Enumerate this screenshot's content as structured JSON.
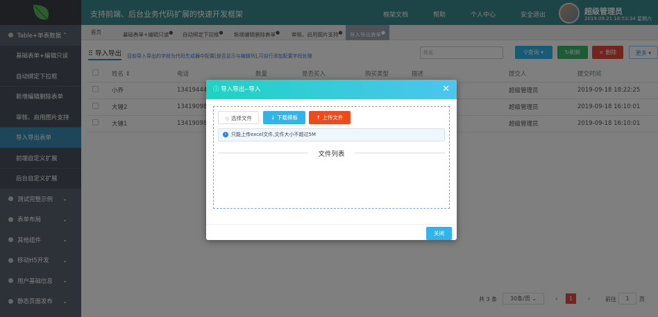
{
  "header": {
    "slogan": "支持前端、后台业务代码扩展的快速开发框架",
    "nav": [
      "框架文档",
      "帮助",
      "个人中心",
      "安全退出"
    ],
    "user_name": "超级管理员",
    "datetime": "2019.09.21 18:53:34 星期六"
  },
  "sidebar": {
    "items": [
      {
        "label": "Table+单表数据",
        "type": "top",
        "expanded": true
      },
      {
        "label": "基础表单+编辑只读",
        "type": "sub"
      },
      {
        "label": "自动绑定下拉框",
        "type": "sub"
      },
      {
        "label": "新增编辑删除表单",
        "type": "sub"
      },
      {
        "label": "审核、启用图片支持",
        "type": "sub"
      },
      {
        "label": "导入导出表单",
        "type": "sub",
        "active": true
      },
      {
        "label": "前端自定义扩展",
        "type": "sub"
      },
      {
        "label": "后台自定义扩展",
        "type": "sub"
      },
      {
        "label": "测试完整示例",
        "type": "top"
      },
      {
        "label": "表单布局",
        "type": "top"
      },
      {
        "label": "其他组件",
        "type": "top"
      },
      {
        "label": "移动H5开发",
        "type": "top"
      },
      {
        "label": "用户基础信息",
        "type": "top"
      },
      {
        "label": "静态页面发布",
        "type": "top"
      }
    ]
  },
  "tabs": [
    {
      "label": "首页"
    },
    {
      "label": "基础表单+编辑只读"
    },
    {
      "label": "自动绑定下拉框"
    },
    {
      "label": "新增编辑删除表单"
    },
    {
      "label": "审核、启用图片支持"
    },
    {
      "label": "导入导出表单",
      "active": true
    }
  ],
  "page": {
    "title": "导入导出",
    "hint": "目前导入导出的字段为代码生成器中配置[是否显示与编辑列],可自行添加配置字段处理",
    "search_placeholder": "姓名",
    "buttons": {
      "query": "查询",
      "refresh": "刷新",
      "delete": "删除",
      "more": "更多"
    }
  },
  "table": {
    "columns": [
      "姓名",
      "电话",
      "数量",
      "是否买入",
      "购买类型",
      "描述",
      "提交人",
      "提交时间"
    ],
    "rows": [
      [
        "小乔",
        "13419444",
        "",
        "",
        "",
        "",
        "超级管理员",
        "2019-09-18 18:22:25"
      ],
      [
        "大锤2",
        "13419098",
        "",
        "",
        "",
        "",
        "超级管理员",
        "2019-09-18 16:10:01"
      ],
      [
        "大锤1",
        "13419098",
        "",
        "",
        "",
        "",
        "超级管理员",
        "2019-09-18 16:10:01"
      ]
    ]
  },
  "pagination": {
    "total": "共 3 条",
    "page_size": "30条/页",
    "current": "1",
    "goto_label": "前往",
    "goto_value": "1",
    "page_unit": "页"
  },
  "modal": {
    "title": "导入导出--导入",
    "select_file": "选择文件",
    "download_template": "下载模板",
    "upload_file": "上传文件",
    "alert": "只能上传excel文件,文件大小不超过5M",
    "file_list_title": "文件列表",
    "close": "关闭"
  },
  "colors": {
    "header": "#3a8a91",
    "active": "#3c8db5",
    "download": "#2fb5ea",
    "upload": "#ef4a1e",
    "close": "#2fb5ea"
  }
}
